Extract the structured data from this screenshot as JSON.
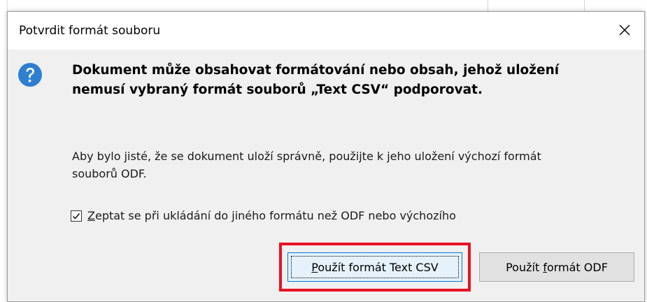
{
  "dialog": {
    "title": "Potvrdit formát souboru",
    "close_icon": "close-icon",
    "icon": "question-icon",
    "heading_line1": "Dokument může obsahovat formátování nebo obsah, jehož uložení",
    "heading_line2": "nemusí vybraný formát souborů „Text CSV“ podporovat.",
    "body_line1": "Aby bylo jisté, že se dokument uloží správně, použijte k jeho uložení výchozí formát",
    "body_line2": "souborů ODF.",
    "checkbox": {
      "checked": true,
      "label_first": "Z",
      "label_rest": "eptat se při ukládání do jiného formátu než ODF nebo výchozího"
    },
    "buttons": {
      "primary_mnemonic": "P",
      "primary_rest": "oužít formát Text CSV",
      "secondary_before": "Použít ",
      "secondary_mnemonic": "f",
      "secondary_after": "ormát ODF"
    }
  },
  "colors": {
    "dialog_bg": "#f0f0f0",
    "accent": "#0078d7",
    "icon_blue": "#2f7fd1",
    "highlight": "#e81123"
  }
}
